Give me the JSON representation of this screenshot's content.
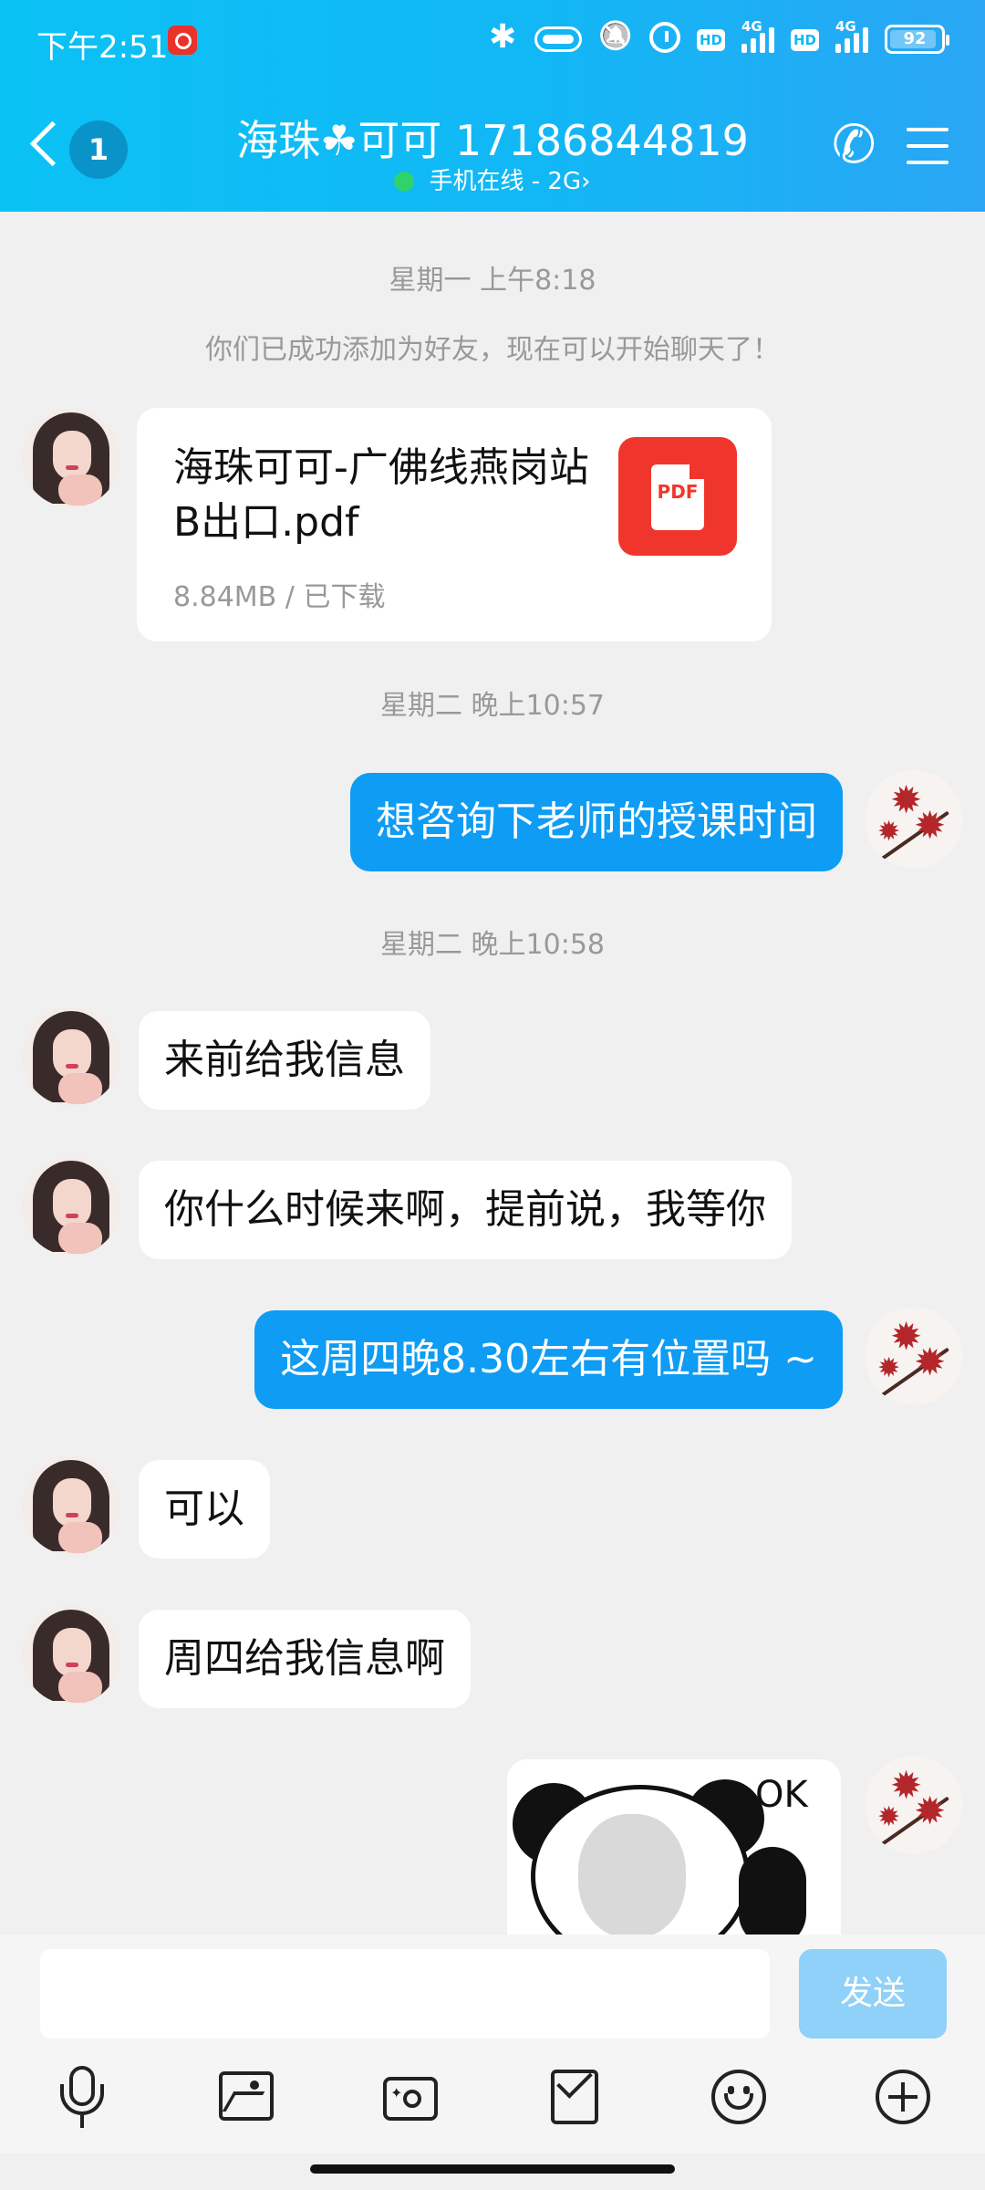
{
  "status_bar": {
    "time": "下午2:51",
    "hd1": "HD",
    "net1": "4G",
    "hd2": "HD",
    "net2": "4G",
    "battery": "92",
    "battery_level": 0.92
  },
  "header": {
    "unread_count": "1",
    "contact_title": "海珠☘可可 17186844819",
    "status_text": "手机在线 - 2G",
    "status_chevron": "›",
    "online_color": "#2ed36b"
  },
  "chat": {
    "timestamp_1": "星期一 上午8:18",
    "system_message": "你们已成功添加为好友，现在可以开始聊天了！",
    "file": {
      "name": "海珠可可-广佛线燕岗站B出口.pdf",
      "meta": "8.84MB / 已下载",
      "icon_label": "PDF"
    },
    "timestamp_2": "星期二 晚上10:57",
    "msg_out_1": "想咨询下老师的授课时间",
    "timestamp_3": "星期二 晚上10:58",
    "msg_in_1": "来前给我信息",
    "msg_in_2": "你什么时候来啊，提前说，我等你",
    "msg_out_2": "这周四晚8.30左右有位置吗 ~",
    "msg_in_3": "可以",
    "msg_in_4": "周四给我信息啊",
    "sticker_text": "OK"
  },
  "input": {
    "send_label": "发送"
  },
  "colors": {
    "header_accent": "#12b7f5",
    "outgoing_bubble": "#0e9cf4",
    "send_button": "#8fd1f9"
  },
  "icons": [
    "back-icon",
    "phone-icon",
    "menu-icon",
    "microphone-icon",
    "image-icon",
    "camera-icon",
    "red-packet-icon",
    "emoji-icon",
    "plus-icon"
  ]
}
